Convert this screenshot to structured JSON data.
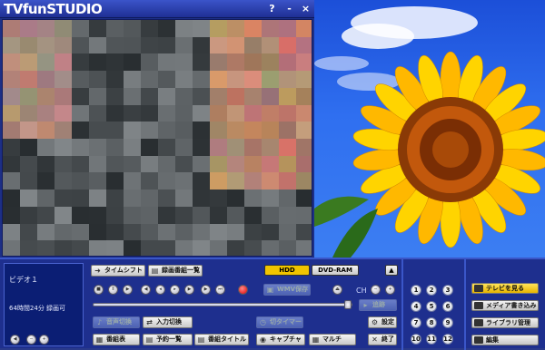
{
  "app": {
    "title": "TVfunSTUDIO",
    "help": "?",
    "minimize": "-",
    "close": "×"
  },
  "info": {
    "channel": "ビデオ１",
    "remaining": "64時間24分 録画可"
  },
  "toolbar": {
    "timeshift": "タイムシフト",
    "recorded_list": "録画番組一覧",
    "hdd": "HDD",
    "dvd": "DVD-RAM",
    "eject": "▲",
    "ch_label": "CH",
    "list_label": "追跡",
    "input_switch": "入力切換",
    "audio_switch": "音声切換",
    "program_table": "番組表",
    "reserve_list": "予約一覧",
    "program_title": "番組タイトル",
    "capture": "キャプチャ",
    "multi": "マルチ",
    "settings": "設定",
    "quit": "終了",
    "timer": "切タイマー",
    "wmv": "WMV保存"
  },
  "channels": [
    "1",
    "2",
    "3",
    "4",
    "5",
    "6",
    "7",
    "8",
    "9",
    "10",
    "11",
    "12"
  ],
  "side": {
    "watch_tv": "テレビを見る",
    "media_write": "メディア書き込み",
    "library": "ライブラリ管理",
    "edit": "編集"
  }
}
